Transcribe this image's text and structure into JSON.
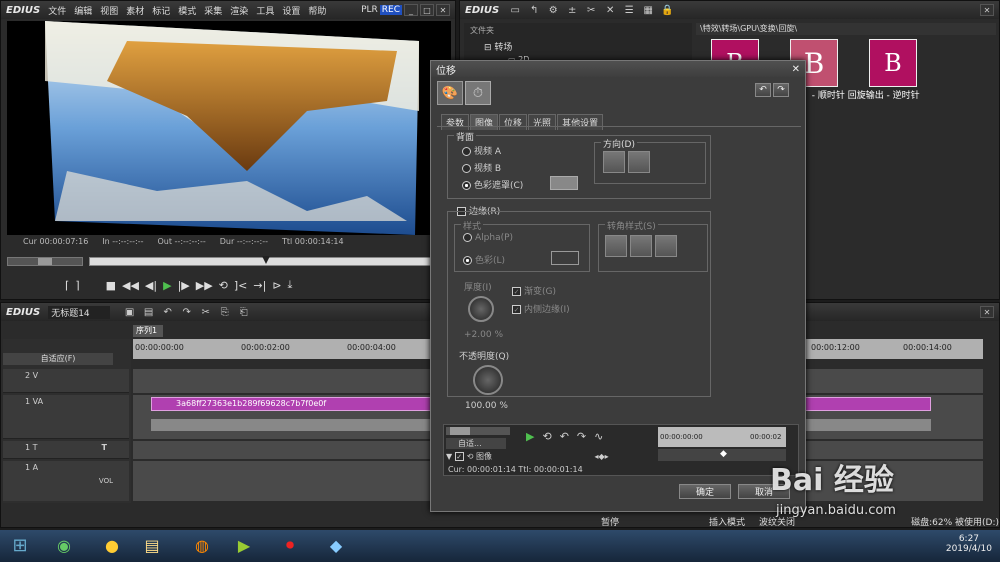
{
  "player": {
    "logo": "EDIUS",
    "menu": [
      "文件",
      "编辑",
      "视图",
      "素材",
      "标记",
      "模式",
      "采集",
      "渲染",
      "工具",
      "设置",
      "帮助"
    ],
    "plr": "PLR",
    "rec": "REC",
    "cur_label": "Cur",
    "cur": "00:00:07:16",
    "in_label": "In",
    "in": "--:--:--:--",
    "out_label": "Out",
    "out": "--:--:--:--",
    "dur_label": "Dur",
    "dur": "--:--:--:--",
    "ttl_label": "Ttl",
    "ttl": "00:00:14:14"
  },
  "bin": {
    "logo": "EDIUS",
    "folder_header": "文件夹",
    "tree_item": "转场",
    "tree_sub": "2D",
    "path": "\\特效\\转场\\GPU\\变换\\回旋\\",
    "clip_caption": "  - 顺时针  回旋输出 - 逆时针"
  },
  "timeline": {
    "logo": "EDIUS",
    "project": "无标题14",
    "sequence_tab": "序列1",
    "fit_label": "自适应(F)",
    "ruler": [
      "00:00:00:00",
      "00:00:02:00",
      "00:00:04:00"
    ],
    "ruler_right": [
      "00:00:12:00",
      "00:00:14:00"
    ],
    "tracks": [
      {
        "name": "2 V"
      },
      {
        "name": "1 VA"
      },
      {
        "name": "1 T"
      },
      {
        "name": "1 A",
        "extra": "VOL"
      }
    ],
    "clip_name": "3a68ff27363e1b289f69628c7b7f0e0f"
  },
  "dialog": {
    "title": "位移",
    "tabs": [
      "参数",
      "图像",
      "位移",
      "光照",
      "其他设置"
    ],
    "active_tab_index": 1,
    "background_group": "背面",
    "radio_video_a": "视频 A",
    "radio_video_b": "视频 B",
    "radio_color": "色彩遮罩(C)",
    "direction_group": "方向(D)",
    "border_checkbox": "边缘(R)",
    "style_group": "样式",
    "style_alpha": "Alpha(P)",
    "style_color": "色彩(L)",
    "corner_group": "转角样式(S)",
    "thickness_label": "厚度(I)",
    "thickness_value": "+2.00 %",
    "gradient_label": "渐变(G)",
    "inner_edge_label": "内侧边缘(I)",
    "opacity_label": "不透明度(Q)",
    "opacity_value": "100.00 %",
    "auto_label": "自适...",
    "kf_ruler": [
      "00:00:00:00",
      "00:00:02"
    ],
    "kf_track": "图像",
    "cur_line": "Cur: 00:00:01:14  Ttl: 00:00:01:14",
    "ok": "确定",
    "cancel": "取消"
  },
  "status": {
    "pause": "暂停",
    "insert_mode": "插入模式",
    "ripple_off": "波纹关闭",
    "disk": "磁盘:62% 被使用(D:)"
  },
  "taskbar": {
    "time": "6:27",
    "date": "2019/4/10"
  },
  "watermark": {
    "brand": "Bai 经验",
    "url": "jingyan.baidu.com"
  }
}
